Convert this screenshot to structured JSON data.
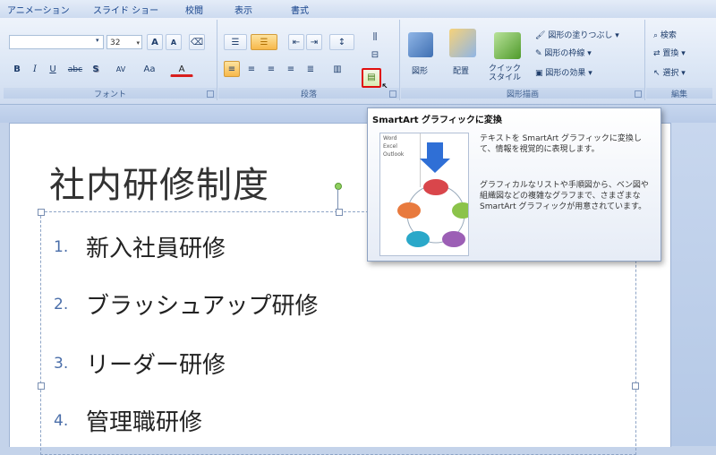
{
  "ribbon_tabs": [
    "アニメーション",
    "スライド ショー",
    "校閲",
    "表示",
    "書式"
  ],
  "font": {
    "name_value": "",
    "size_value": "32",
    "group_label": "フォント",
    "bold": "B",
    "italic": "I",
    "underline": "U",
    "strike": "abc",
    "shadow": "S",
    "spacing": "AV",
    "case": "Aa",
    "color": "A",
    "grow": "A",
    "shrink": "A"
  },
  "paragraph": {
    "group_label": "段落"
  },
  "drawing": {
    "group_label": "図形描画",
    "shapes_label": "図形",
    "arrange_label": "配置",
    "quick_style_label": "クイック\nスタイル",
    "fill_label": "図形の塗りつぶし",
    "outline_label": "図形の枠線",
    "effects_label": "図形の効果"
  },
  "editing": {
    "group_label": "編集",
    "find_label": "検索",
    "replace_label": "置換",
    "select_label": "選択"
  },
  "slide": {
    "title": "社内研修制度",
    "items": [
      {
        "num": "1.",
        "text": "新入社員研修"
      },
      {
        "num": "2.",
        "text": "ブラッシュアップ研修"
      },
      {
        "num": "3.",
        "text": "リーダー研修"
      },
      {
        "num": "4.",
        "text": "管理職研修"
      }
    ]
  },
  "tooltip": {
    "title": "SmartArt グラフィックに変換",
    "desc1": "テキストを SmartArt グラフィックに変換して、情報を視覚的に表現します。",
    "desc2": "グラフィカルなリストや手順図から、ベン図や組織図などの複雑なグラフまで、さまざまな SmartArt グラフィックが用意されています。",
    "preview_items": [
      "Word",
      "Excel",
      "Outlook"
    ]
  },
  "colors": {
    "accent": "#15428b",
    "highlight_border": "#e01010",
    "number_color": "#4a6ea9"
  }
}
